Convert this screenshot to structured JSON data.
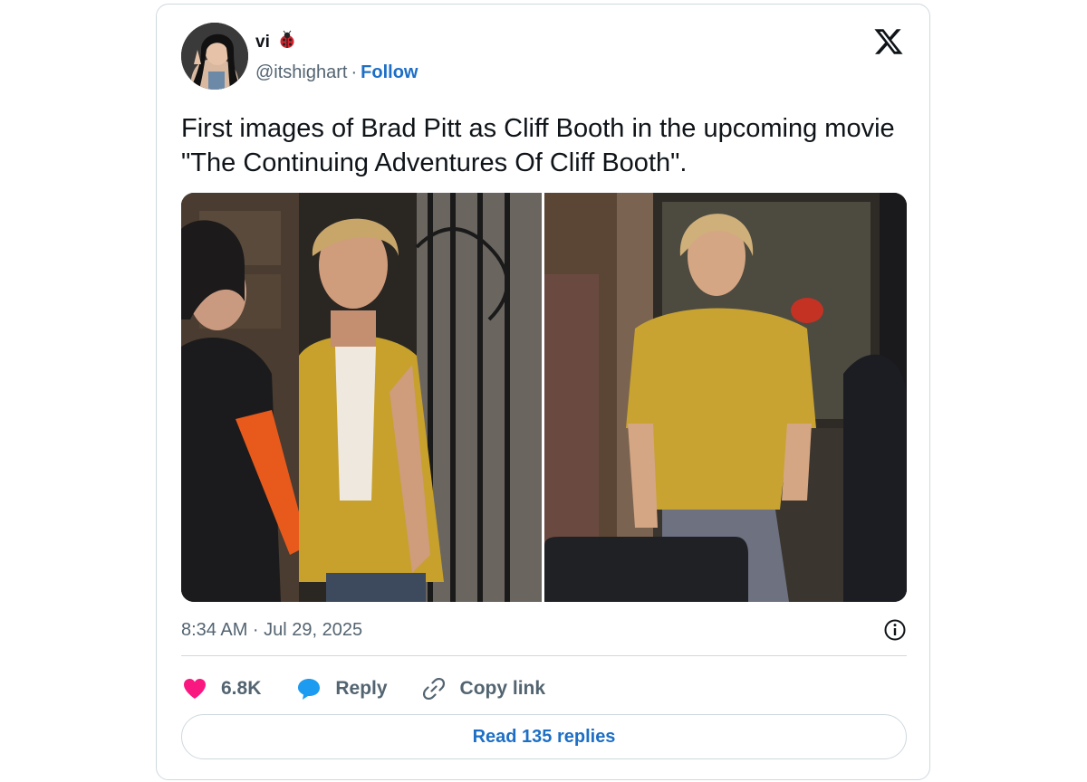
{
  "author": {
    "display_name": "vi",
    "name_emoji": "ladybug-icon",
    "handle": "@itshighart",
    "separator": "·",
    "follow_label": "Follow"
  },
  "tweet": {
    "text": "First images of Brad Pitt as Cliff Booth in the upcoming movie \"The Continuing Adventures Of Cliff Booth\".",
    "timestamp": "8:34 AM · Jul 29, 2025"
  },
  "actions": {
    "likes": "6.8K",
    "reply_label": "Reply",
    "copy_link_label": "Copy link"
  },
  "read_replies_label": "Read 135 replies",
  "colors": {
    "link_blue": "#1d6fc6",
    "like_pink": "#f91880",
    "reply_blue": "#1d9bf0",
    "muted": "#536471",
    "border": "#cfd9de"
  }
}
